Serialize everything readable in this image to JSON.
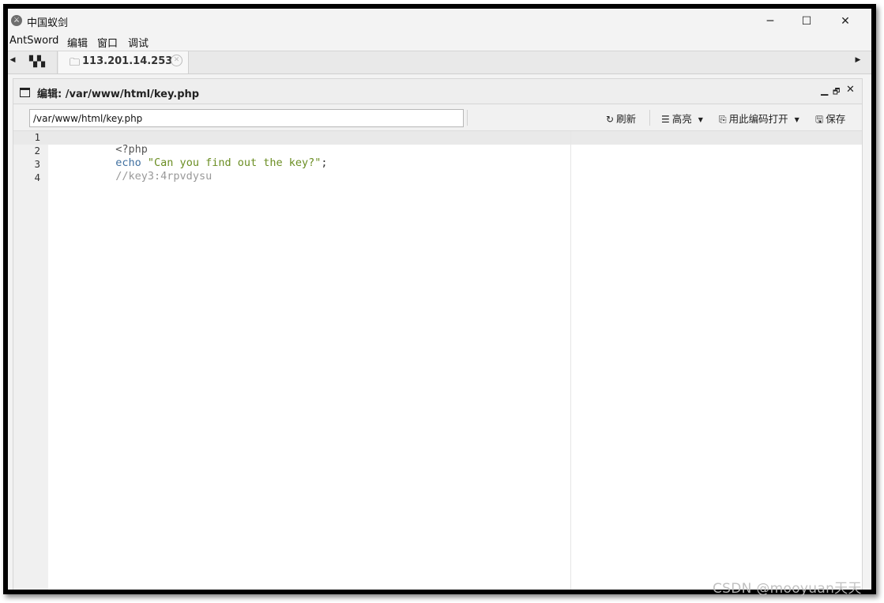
{
  "window": {
    "title": "中国蚁剑",
    "app_icon": "antsword-logo-icon",
    "controls": {
      "minimize": "─",
      "maximize": "☐",
      "close": "✕"
    }
  },
  "menubar": {
    "items": [
      {
        "label": "AntSword"
      },
      {
        "label": "编辑"
      },
      {
        "label": "窗口"
      },
      {
        "label": "调试"
      }
    ]
  },
  "tabs": {
    "home_icon": "grid-icon",
    "items": [
      {
        "label": "113.201.14.253",
        "icon": "folder-icon"
      }
    ]
  },
  "panel": {
    "title": "编辑: /var/www/html/key.php",
    "controls": {
      "minimize": "▁",
      "restore": "🗗",
      "close": "✕"
    }
  },
  "toolbar": {
    "path_value": "/var/www/html/key.php",
    "refresh_label": "刷新",
    "highlight_label": "高亮",
    "open_encoding_label": "用此编码打开",
    "save_label": "保存"
  },
  "editor": {
    "active_line": 1,
    "lines": [
      {
        "num": "1",
        "tokens": [
          {
            "text": "<?php",
            "color": "#555555"
          }
        ]
      },
      {
        "num": "2",
        "tokens": [
          {
            "text": "echo ",
            "color": "#4070a0"
          },
          {
            "text": "\"Can you find out the key?\"",
            "color": "#6b8e23"
          },
          {
            "text": ";",
            "color": "#333333"
          }
        ]
      },
      {
        "num": "3",
        "tokens": [
          {
            "text": "//key3:4rpvdysu",
            "color": "#999999"
          }
        ]
      },
      {
        "num": "4",
        "tokens": []
      }
    ]
  },
  "watermark": "CSDN @mooyuan天天"
}
